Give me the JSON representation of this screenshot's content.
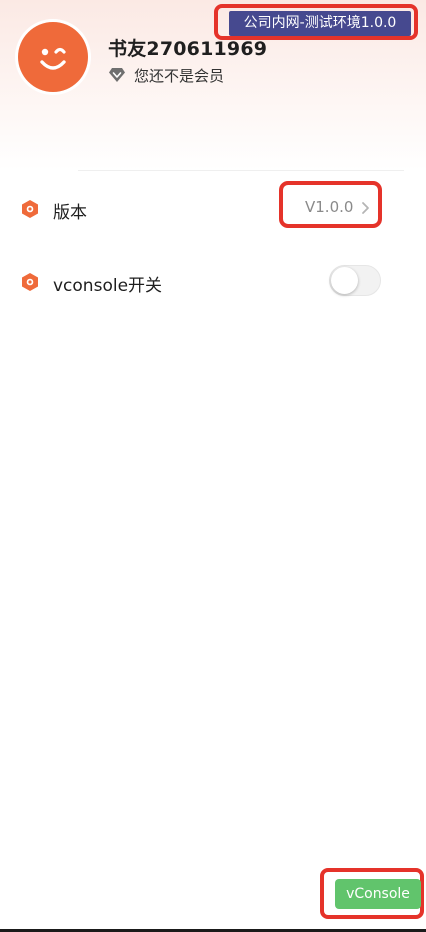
{
  "header": {
    "username": "书友270611969",
    "vip_status": "您还不是会员",
    "env_badge": "公司内网-测试环境1.0.0"
  },
  "settings": {
    "version_label": "版本",
    "version_value": "V1.0.0",
    "vconsole_label": "vconsole开关",
    "vconsole_enabled": false
  },
  "vconsole_button": "vConsole",
  "colors": {
    "accent": "#ef6a3a",
    "env_badge_bg": "#46498f",
    "vconsole_green": "#61c46c",
    "highlight_red": "#e5332a"
  },
  "icons": [
    "avatar-face",
    "diamond-icon",
    "hexagon-icon",
    "chevron-right-icon"
  ]
}
